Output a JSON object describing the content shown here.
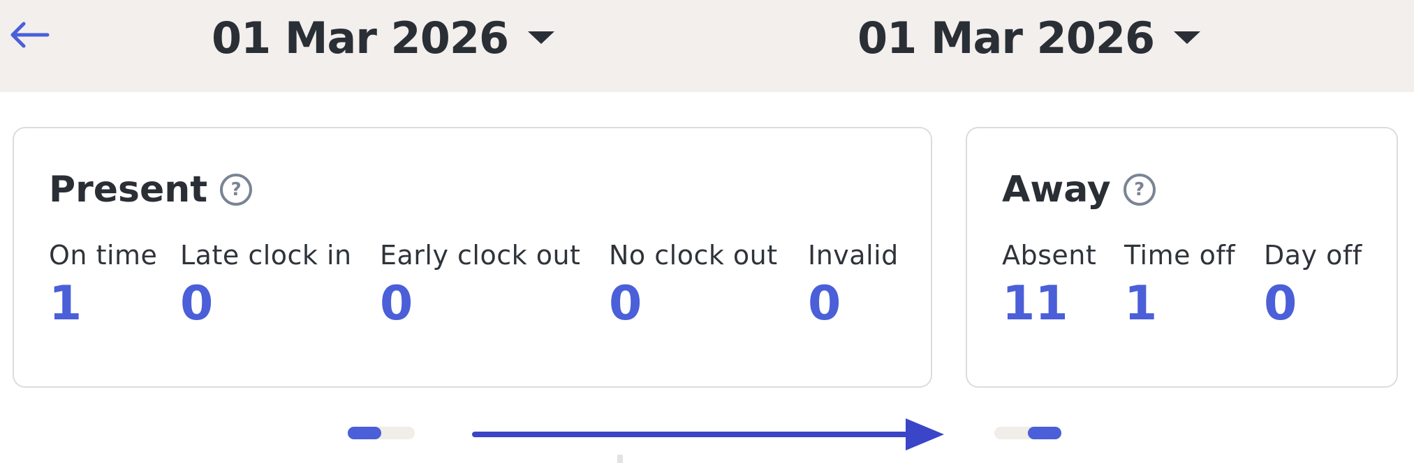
{
  "header": {
    "back_icon": "arrow-left-icon",
    "date_from": "01 Mar 2026",
    "date_to": "01 Mar 2026"
  },
  "present": {
    "title": "Present",
    "help_icon": "?",
    "stats": [
      {
        "label": "On time",
        "value": "1"
      },
      {
        "label": "Late clock in",
        "value": "0"
      },
      {
        "label": "Early clock out",
        "value": "0"
      },
      {
        "label": "No clock out",
        "value": "0"
      },
      {
        "label": "Invalid",
        "value": "0"
      }
    ]
  },
  "away": {
    "title": "Away",
    "help_icon": "?",
    "stats": [
      {
        "label": "Absent",
        "value": "11"
      },
      {
        "label": "Time off",
        "value": "1"
      },
      {
        "label": "Day off",
        "value": "0"
      }
    ]
  },
  "pager": {
    "current_page": 1,
    "page_count": 2
  },
  "colors": {
    "accent": "#4a5fd8",
    "header_bg": "#f2efed",
    "text": "#2a2e35",
    "muted_icon": "#7a8494",
    "card_border": "#dcdcdf",
    "swipe_arrow": "#3a45c8"
  }
}
